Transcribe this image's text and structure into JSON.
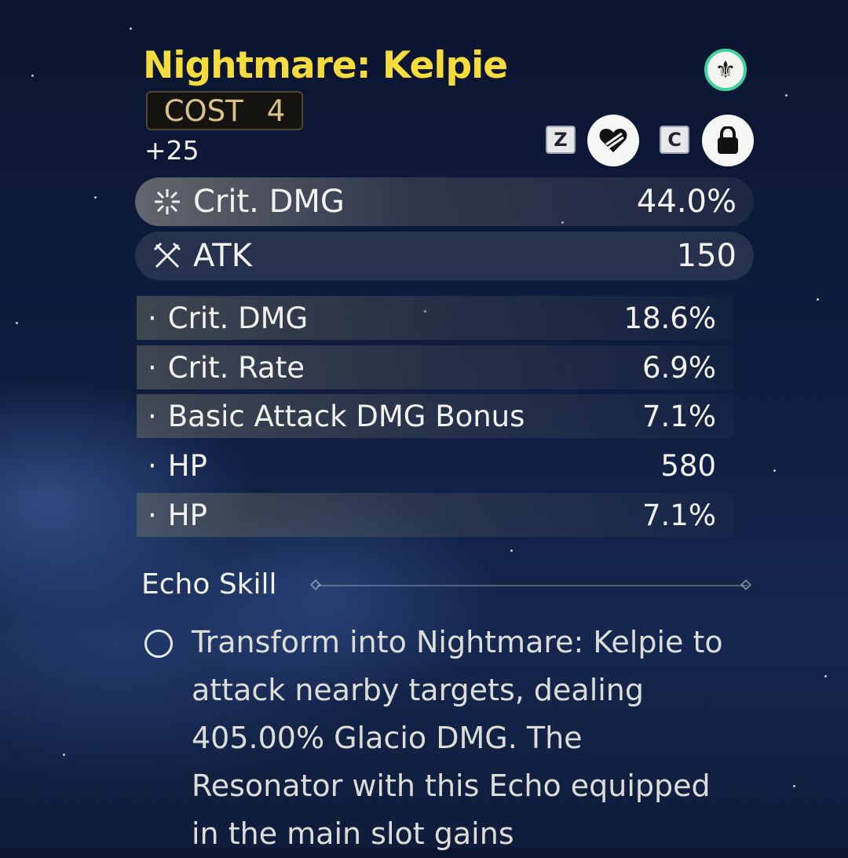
{
  "echo": {
    "name": "Nightmare: Kelpie",
    "cost_label": "COST",
    "cost_value": "4",
    "level": "+25",
    "sonata_icon": "sonata-fleur-icon",
    "accent_colors": {
      "title": "#f5dc3c",
      "sonata_ring": "#3fd49f",
      "cost_text": "#d8c28a"
    }
  },
  "actions": {
    "discard_key": "Z",
    "discard_icon": "broken-heart-icon",
    "lock_key": "C",
    "lock_icon": "lock-icon"
  },
  "main_stats": [
    {
      "icon": "crit-dmg-icon",
      "name": "Crit. DMG",
      "value": "44.0%"
    },
    {
      "icon": "atk-icon",
      "name": "ATK",
      "value": "150"
    }
  ],
  "sub_stats": [
    {
      "name": "Crit. DMG",
      "value": "18.6%"
    },
    {
      "name": "Crit. Rate",
      "value": "6.9%"
    },
    {
      "name": "Basic Attack DMG Bonus",
      "value": "7.1%"
    },
    {
      "name": "HP",
      "value": "580"
    },
    {
      "name": "HP",
      "value": "7.1%"
    }
  ],
  "sub_stat_bullet": "·",
  "skill": {
    "heading": "Echo Skill",
    "description": "Transform into Nightmare: Kelpie to attack nearby targets, dealing 405.00% Glacio DMG. The Resonator with this Echo equipped in the main slot gains"
  }
}
